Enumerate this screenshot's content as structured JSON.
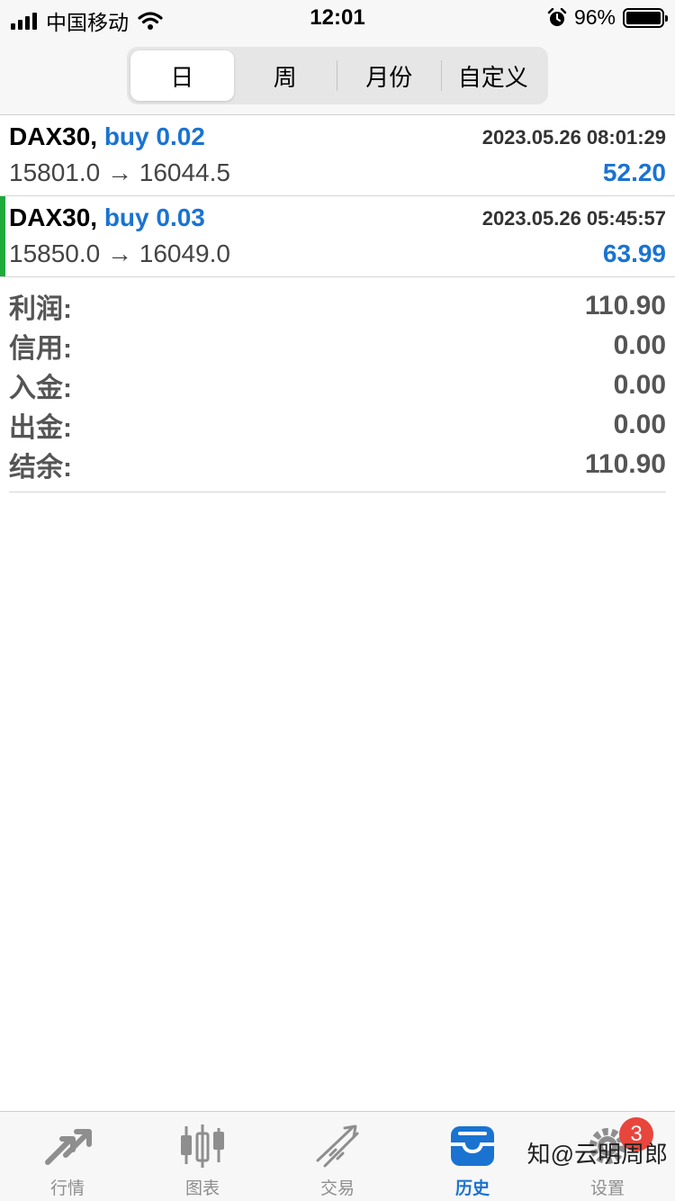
{
  "status_bar": {
    "carrier": "中国移动",
    "time": "12:01",
    "battery_percent": "96%"
  },
  "period_tabs": [
    {
      "label": "日",
      "active": true
    },
    {
      "label": "周",
      "active": false
    },
    {
      "label": "月份",
      "active": false
    },
    {
      "label": "自定义",
      "active": false
    }
  ],
  "trades": [
    {
      "symbol": "DAX30,",
      "side": "buy 0.02",
      "datetime": "2023.05.26 08:01:29",
      "prices": "15801.0 → 16044.5",
      "profit": "52.20"
    },
    {
      "symbol": "DAX30,",
      "side": "buy 0.03",
      "datetime": "2023.05.26 05:45:57",
      "prices": "15850.0 → 16049.0",
      "profit": "63.99"
    }
  ],
  "summary": [
    {
      "label": "利润:",
      "value": "110.90"
    },
    {
      "label": "信用:",
      "value": "0.00"
    },
    {
      "label": "入金:",
      "value": "0.00"
    },
    {
      "label": "出金:",
      "value": "0.00"
    },
    {
      "label": "结余:",
      "value": "110.90"
    }
  ],
  "tab_bar": [
    {
      "label": "行情",
      "icon": "quotes-icon",
      "active": false
    },
    {
      "label": "图表",
      "icon": "chart-icon",
      "active": false
    },
    {
      "label": "交易",
      "icon": "trade-icon",
      "active": false
    },
    {
      "label": "历史",
      "icon": "history-icon",
      "active": true
    },
    {
      "label": "设置",
      "icon": "gear-icon",
      "active": false,
      "badge": "3"
    }
  ],
  "watermark": "知@云明周郎",
  "colors": {
    "accent": "#1a73d1",
    "selected_bar": "#1faa3a",
    "badge": "#e8453c"
  }
}
